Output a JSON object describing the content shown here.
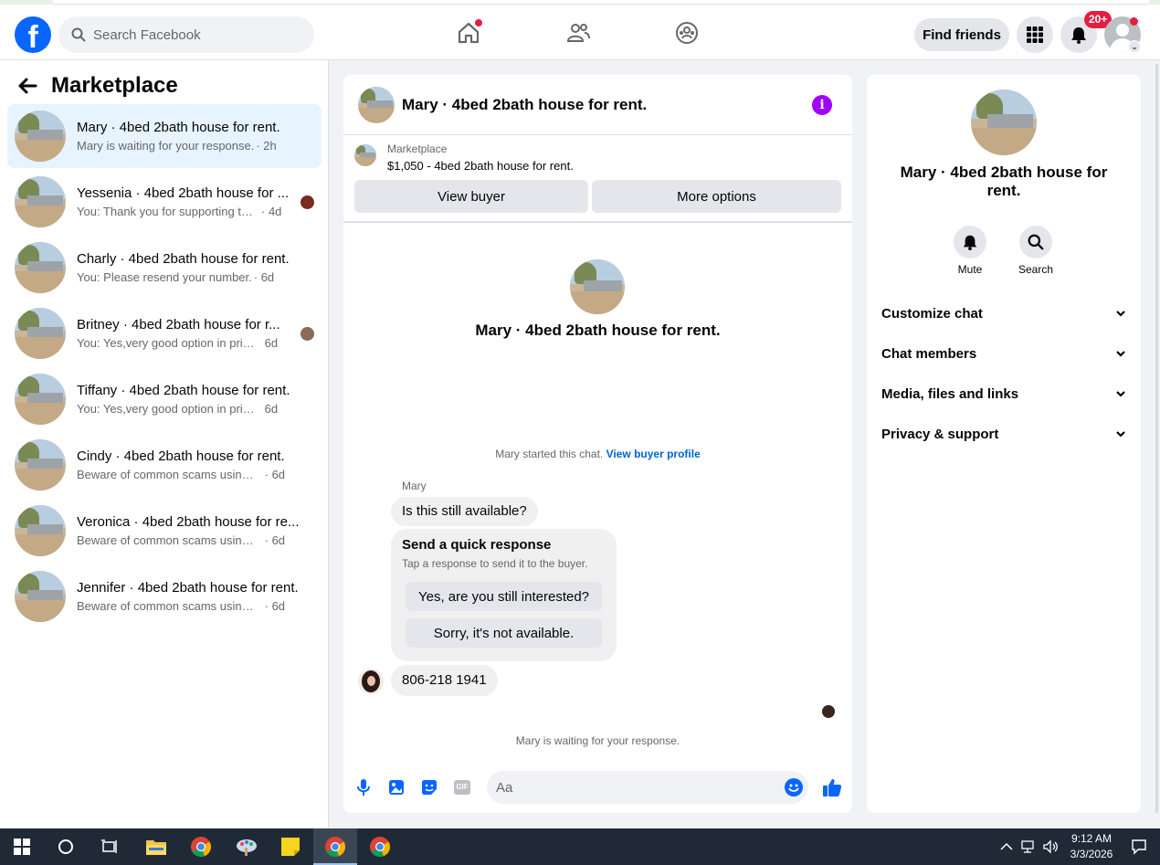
{
  "topbar": {
    "search_placeholder": "Search Facebook",
    "find_friends_label": "Find friends",
    "notifications_badge": "20+"
  },
  "sidebar": {
    "title": "Marketplace",
    "conversations": [
      {
        "name": "Mary · 4bed 2bath house for rent.",
        "message": "Mary is waiting for your response.",
        "time": "· 2h",
        "active": true
      },
      {
        "name": "Yessenia · 4bed 2bath house for ...",
        "message": "You: Thank you for supporting the ...",
        "time": "· 4d"
      },
      {
        "name": "Charly · 4bed 2bath house for rent.",
        "message": "You: Please resend your number.",
        "time": "· 6d"
      },
      {
        "name": "Britney · 4bed 2bath house for r...",
        "message": "You: Yes,very good option in prime ...",
        "time": "6d"
      },
      {
        "name": "Tiffany · 4bed 2bath house for rent.",
        "message": "You: Yes,very good option in prime lo...",
        "time": "6d"
      },
      {
        "name": "Cindy · 4bed 2bath house for rent.",
        "message": "Beware of common scams using pay...",
        "time": "· 6d"
      },
      {
        "name": "Veronica · 4bed 2bath house for re...",
        "message": "Beware of common scams using pay...",
        "time": "· 6d"
      },
      {
        "name": "Jennifer · 4bed 2bath house for rent.",
        "message": "Beware of common scams using pay...",
        "time": "· 6d"
      }
    ]
  },
  "chat": {
    "title": "Mary · 4bed 2bath house for rent.",
    "listing_label": "Marketplace",
    "listing_price": "$1,050 - 4bed 2bath house for rent.",
    "view_buyer": "View buyer",
    "more_options": "More options",
    "center_name": "Mary · 4bed 2bath house for rent.",
    "started_text": "Mary started this chat.",
    "view_buyer_profile": "View buyer profile",
    "sender": "Mary",
    "message1": "Is this still available?",
    "quick_title": "Send a quick response",
    "quick_sub": "Tap a response to send it to the buyer.",
    "quick_yes": "Yes, are you still interested?",
    "quick_no": "Sorry, it's not available.",
    "message2": "806-218 1941",
    "waiting": "Mary is waiting for your response.",
    "input_placeholder": "Aa"
  },
  "right_panel": {
    "name": "Mary · 4bed 2bath house for rent.",
    "mute": "Mute",
    "search": "Search",
    "sections": [
      "Customize chat",
      "Chat members",
      "Media, files and links",
      "Privacy & support"
    ]
  },
  "taskbar": {
    "time": "9:12 AM",
    "date": "3/3/2026"
  },
  "colors": {
    "brand": "#0866ff",
    "active_conversation": "#e7f3ff",
    "info_icon": "#a100ff",
    "badge": "#e41e3f"
  }
}
